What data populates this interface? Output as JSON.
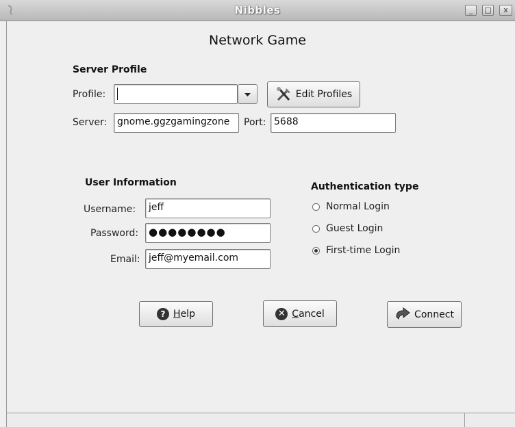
{
  "window": {
    "title": "Nibbles",
    "minimize_glyph": "_",
    "maximize_glyph": "□",
    "close_glyph": "x"
  },
  "dialog": {
    "heading": "Network Game"
  },
  "server_profile": {
    "section_label": "Server Profile",
    "profile_label": "Profile:",
    "profile_value": "",
    "edit_profiles_label": "Edit Profiles",
    "server_label": "Server:",
    "server_value": "gnome.ggzgamingzone",
    "port_label": "Port:",
    "port_value": "5688"
  },
  "user_info": {
    "section_label": "User Information",
    "username_label": "Username:",
    "username_value": "jeff",
    "password_label": "Password:",
    "password_value": "●●●●●●●●",
    "email_label": "Email:",
    "email_value": "jeff@myemail.com"
  },
  "auth": {
    "section_label": "Authentication type",
    "options": [
      {
        "label": "Normal Login",
        "selected": false
      },
      {
        "label": "Guest Login",
        "selected": false
      },
      {
        "label": "First-time Login",
        "selected": true
      }
    ]
  },
  "buttons": {
    "help_mnemonic": "H",
    "help_rest": "elp",
    "cancel_mnemonic": "C",
    "cancel_rest": "ancel",
    "connect_label": "Connect"
  },
  "icons": {
    "app": "nibbles-app-icon",
    "dropdown": "chevron-down-icon",
    "edit": "tools-icon",
    "help": "help-icon",
    "cancel": "cancel-icon",
    "connect": "connect-arrow-icon"
  },
  "colors": {
    "window_bg": "#efefef",
    "titlebar": "#c8c8c8",
    "entry_bg": "#ffffff"
  }
}
